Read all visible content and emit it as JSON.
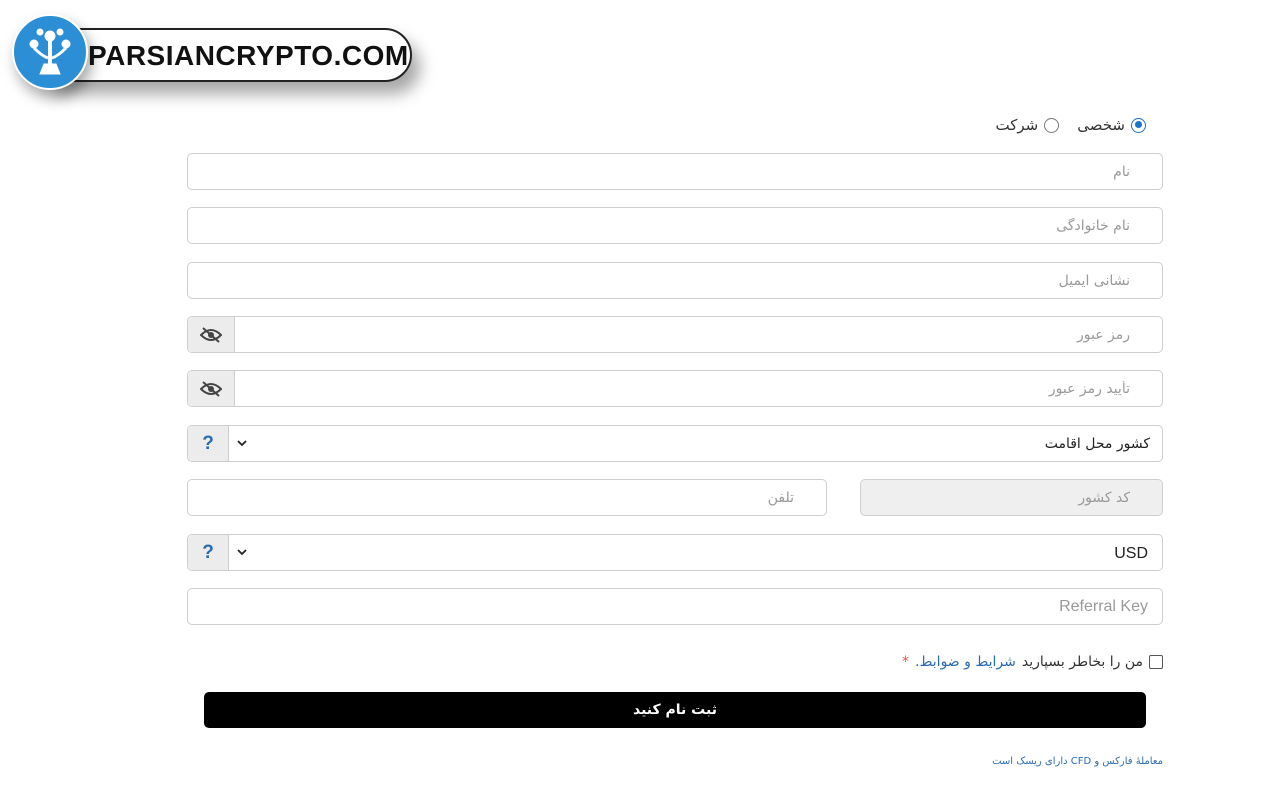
{
  "logo": {
    "text": "PARSIANCRYPTO.COM"
  },
  "account_type": {
    "options": [
      {
        "label": "شخصی",
        "selected": true
      },
      {
        "label": "شرکت",
        "selected": false
      }
    ]
  },
  "fields": {
    "first_name_placeholder": "نام",
    "last_name_placeholder": "نام خانوادگی",
    "email_placeholder": "نشانی ایمیل",
    "password_placeholder": "رمز عبور",
    "confirm_password_placeholder": "تأیید رمز عبور",
    "country_value": "کشور محل اقامت",
    "country_code_placeholder": "کد کشور",
    "phone_placeholder": "تلفن",
    "currency_value": "USD",
    "referral_placeholder": "Referral Key"
  },
  "help_label": "?",
  "terms": {
    "prefix": "من را بخاطر بسپارید",
    "link": "شرایط و ضوابط.",
    "required_mark": "*",
    "checked": false
  },
  "submit_label": "ثبت نام کنید",
  "risk_notice": "معاملهٔ فارکس و CFD دارای ریسک است",
  "colors": {
    "accent": "#2b6cb0",
    "button": "#000000",
    "logo_circle": "#2c8fd6"
  }
}
